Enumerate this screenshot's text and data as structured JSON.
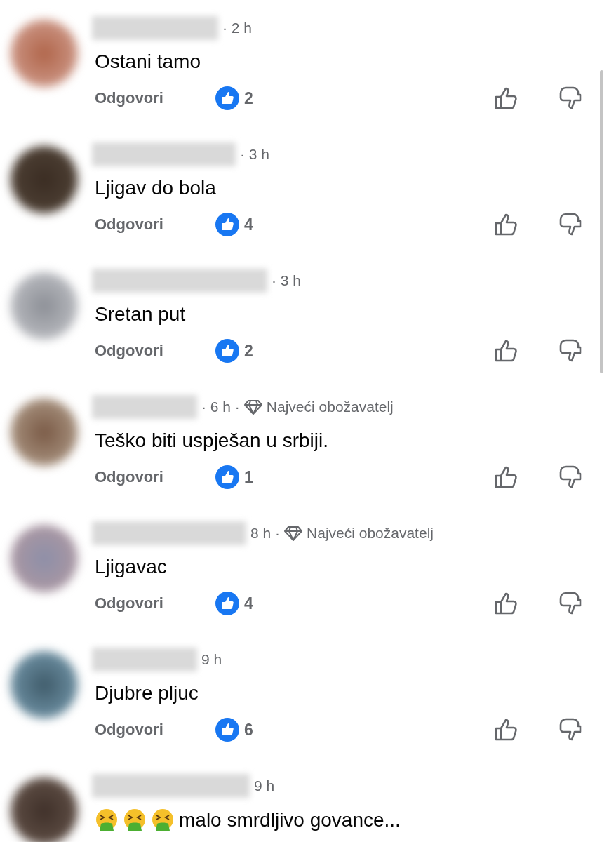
{
  "comments": [
    {
      "time": "· 2 h",
      "text": "Ostani tamo",
      "reply": "Odgovori",
      "likes": "2",
      "kind": "plain"
    },
    {
      "time": "· 3 h",
      "text": "Ljigav do bola",
      "reply": "Odgovori",
      "likes": "4",
      "kind": "plain"
    },
    {
      "time": "· 3 h",
      "text": "Sretan put",
      "reply": "Odgovori",
      "likes": "2",
      "kind": "plain"
    },
    {
      "time": "· 6 h ·",
      "badge": "Najveći obožavatelj",
      "text": "Teško biti uspješan u srbiji.",
      "reply": "Odgovori",
      "likes": "1",
      "kind": "plain"
    },
    {
      "time": "8 h ·",
      "badge": "Najveći obožavatelj",
      "text": "Ljigavac",
      "reply": "Odgovori",
      "likes": "4",
      "kind": "plain"
    },
    {
      "time": "9 h",
      "text": "Djubre pljuc",
      "reply": "Odgovori",
      "likes": "6",
      "kind": "plain"
    },
    {
      "time": "9 h",
      "text": "malo smrdljivo govance...",
      "kind": "emoji"
    }
  ]
}
